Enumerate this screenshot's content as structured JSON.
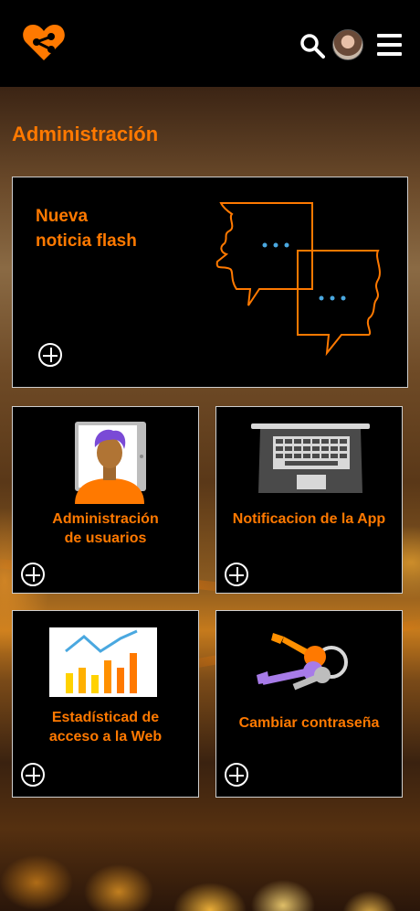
{
  "header": {
    "logo_icon": "heart-share-icon",
    "search_icon": "search-icon",
    "avatar": "user-avatar",
    "menu_icon": "hamburger-menu-icon"
  },
  "page": {
    "title": "Administración"
  },
  "colors": {
    "accent": "#ff7900",
    "card_bg": "#000000",
    "border": "#cfcfcf"
  },
  "cards": {
    "flash": {
      "title_line1": "Nueva",
      "title_line2": "noticia flash",
      "icon": "chat-faces-icon"
    },
    "users": {
      "title_line1": "Administración",
      "title_line2": "de usuarios",
      "icon": "user-tablet-icon"
    },
    "notifications": {
      "title": "Notificacion de la App",
      "icon": "laptop-icon"
    },
    "stats": {
      "title_line1": "Estadísticad de",
      "title_line2": "acceso a la Web",
      "icon": "bar-chart-icon"
    },
    "password": {
      "title": "Cambiar contraseña",
      "icon": "keys-icon"
    }
  }
}
